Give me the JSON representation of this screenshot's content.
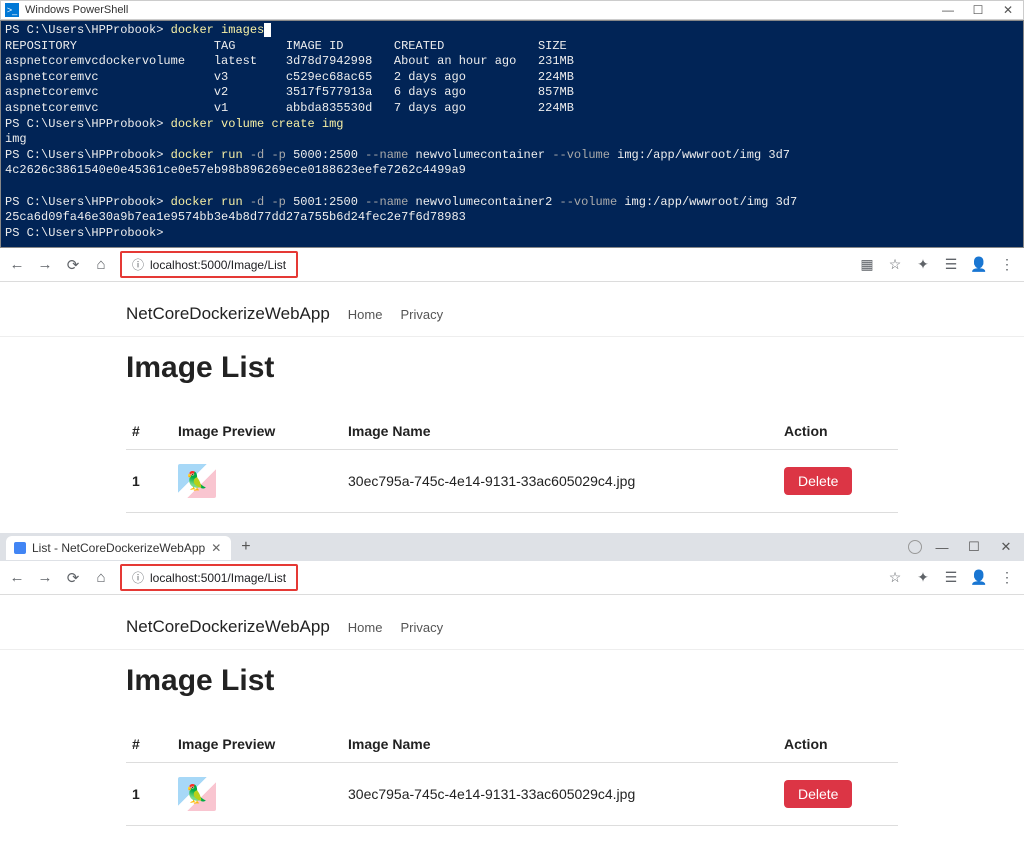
{
  "ps": {
    "title": "Windows PowerShell",
    "prompt": "PS C:\\Users\\HPProbook>",
    "cmd_images": "docker images",
    "header": {
      "repo": "REPOSITORY",
      "tag": "TAG",
      "id": "IMAGE ID",
      "created": "CREATED",
      "size": "SIZE"
    },
    "rows": [
      {
        "repo": "aspnetcoremvcdockervolume",
        "tag": "latest",
        "id": "3d78d7942998",
        "created": "About an hour ago",
        "size": "231MB"
      },
      {
        "repo": "aspnetcoremvc",
        "tag": "v3",
        "id": "c529ec68ac65",
        "created": "2 days ago",
        "size": "224MB"
      },
      {
        "repo": "aspnetcoremvc",
        "tag": "v2",
        "id": "3517f577913a",
        "created": "6 days ago",
        "size": "857MB"
      },
      {
        "repo": "aspnetcoremvc",
        "tag": "v1",
        "id": "abbda835530d",
        "created": "7 days ago",
        "size": "224MB"
      }
    ],
    "cmd_volcreate": "docker volume create img",
    "vol_out": "img",
    "cmd_run1_a": "docker run",
    "cmd_run1_flags": " -d -p ",
    "cmd_run1_b": "5000:2500",
    "cmd_run1_nameflag": " --name ",
    "cmd_run1_c": "newvolumecontainer",
    "cmd_run1_volflag": " --volume ",
    "cmd_run1_d": "img:/app/wwwroot/img 3d7",
    "run1_hash": "4c2626c3861540e0e45361ce0e57eb98b896269ece0188623eefe7262c4499a9",
    "cmd_run2_a": "docker run",
    "cmd_run2_flags": " -d -p ",
    "cmd_run2_b": "5001:2500",
    "cmd_run2_nameflag": " --name ",
    "cmd_run2_c": "newvolumecontainer2",
    "cmd_run2_volflag": " --volume ",
    "cmd_run2_d": "img:/app/wwwroot/img 3d7",
    "run2_hash": "25ca6d09fa46e30a9b7ea1e9574bb3e4b8d77dd27a755b6d24fec2e7f6d78983"
  },
  "browser1": {
    "url_host": "localhost:",
    "url_port": "5000",
    "url_path": "/Image/List",
    "brand": "NetCoreDockerizeWebApp",
    "nav_home": "Home",
    "nav_privacy": "Privacy",
    "page_title": "Image List",
    "th_num": "#",
    "th_preview": "Image Preview",
    "th_name": "Image Name",
    "th_action": "Action",
    "row_num": "1",
    "row_name": "30ec795a-745c-4e14-9131-33ac605029c4.jpg",
    "btn_delete": "Delete"
  },
  "browser2": {
    "tab_title": "List - NetCoreDockerizeWebApp",
    "url_host": "localhost:",
    "url_port": "5001",
    "url_path": "/Image/List",
    "brand": "NetCoreDockerizeWebApp",
    "nav_home": "Home",
    "nav_privacy": "Privacy",
    "page_title": "Image List",
    "th_num": "#",
    "th_preview": "Image Preview",
    "th_name": "Image Name",
    "th_action": "Action",
    "row_num": "1",
    "row_name": "30ec795a-745c-4e14-9131-33ac605029c4.jpg",
    "btn_delete": "Delete"
  }
}
